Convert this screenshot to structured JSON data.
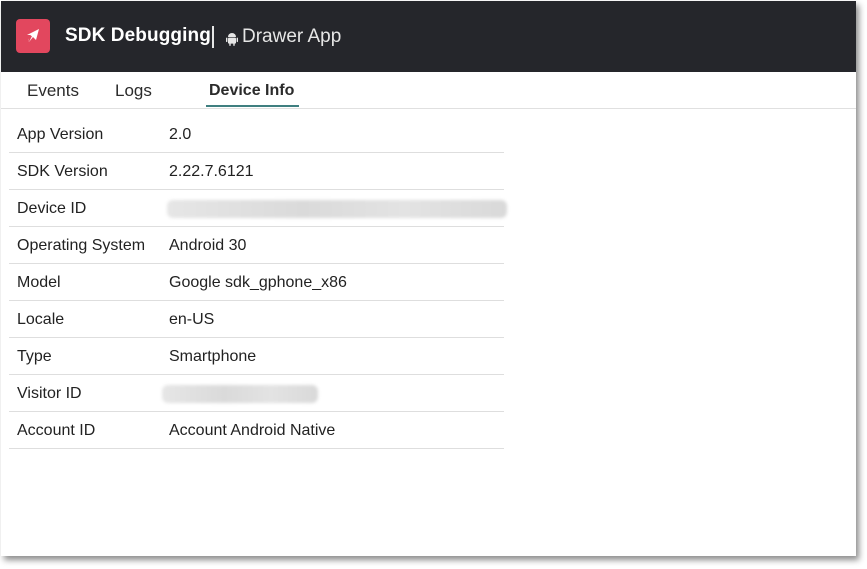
{
  "header": {
    "title": "SDK Debugging",
    "app_name": "Drawer App",
    "logo_icon": "rocket-flag-icon",
    "platform_icon": "android-icon",
    "brand_color": "#e2475e",
    "background_color": "#25262b"
  },
  "tabs": [
    {
      "label": "Events"
    },
    {
      "label": "Logs"
    },
    {
      "label": "Device Info",
      "active": true
    }
  ],
  "device_info": {
    "rows": [
      {
        "label": "App Version",
        "value": "2.0"
      },
      {
        "label": "SDK Version",
        "value": "2.22.7.6121"
      },
      {
        "label": "Device ID",
        "value": null,
        "redacted": true
      },
      {
        "label": "Operating System",
        "value": "Android 30"
      },
      {
        "label": "Model",
        "value": "Google sdk_gphone_x86"
      },
      {
        "label": "Locale",
        "value": "en-US"
      },
      {
        "label": "Type",
        "value": "Smartphone"
      },
      {
        "label": "Visitor ID",
        "value": null,
        "redacted": true
      },
      {
        "label": "Account ID",
        "value": "Account Android Native"
      }
    ]
  },
  "accent_color": "#3f7f80"
}
